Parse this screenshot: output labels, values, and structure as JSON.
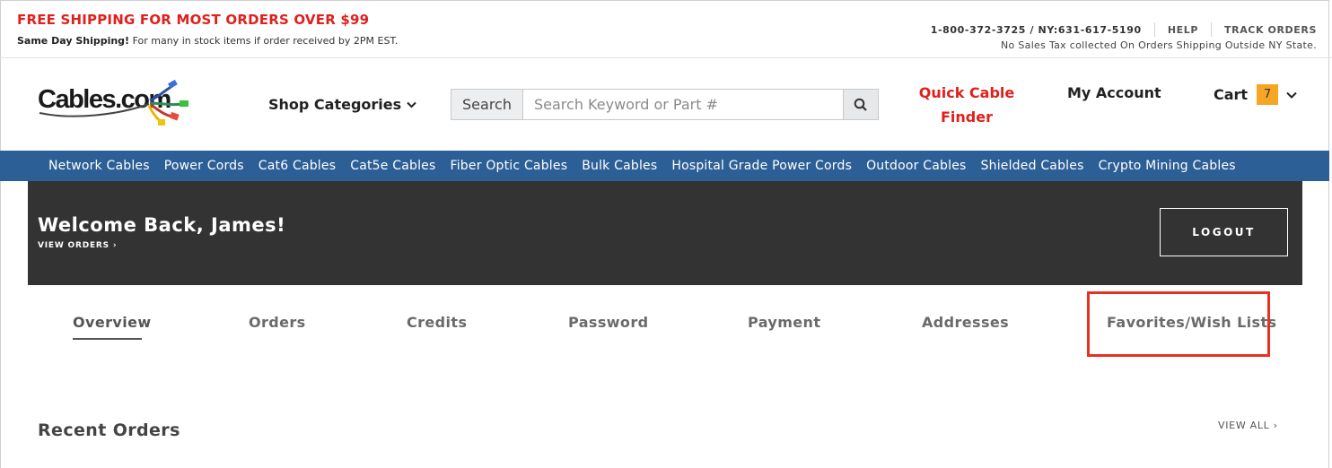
{
  "topbar": {
    "promo": "FREE SHIPPING FOR MOST ORDERS OVER $99",
    "same_day_bold": "Same Day Shipping!",
    "same_day_text": " For many in stock items if order received by 2PM EST.",
    "phone": "1-800-372-3725 / NY:631-617-5190",
    "help": "HELP",
    "track": "TRACK ORDERS",
    "no_sales_tax": "No Sales Tax collected On Orders Shipping Outside NY State."
  },
  "header": {
    "logo_text": "Cables.com",
    "shop_categories": "Shop Categories",
    "search_label": "Search",
    "search_placeholder": "Search Keyword or Part #",
    "search_value": "",
    "quick_finder_line1": "Quick Cable",
    "quick_finder_line2": "Finder",
    "my_account": "My Account",
    "cart_label": "Cart",
    "cart_count": "7"
  },
  "nav": {
    "items": [
      "Network Cables",
      "Power Cords",
      "Cat6 Cables",
      "Cat5e Cables",
      "Fiber Optic Cables",
      "Bulk Cables",
      "Hospital Grade Power Cords",
      "Outdoor Cables",
      "Shielded Cables",
      "Crypto Mining Cables"
    ]
  },
  "welcome": {
    "title": "Welcome Back, James!",
    "view_orders": "VIEW ORDERS ›",
    "logout": "LOGOUT"
  },
  "tabs": {
    "items": [
      "Overview",
      "Orders",
      "Credits",
      "Password",
      "Payment",
      "Addresses",
      "Favorites/Wish Lists"
    ],
    "active": "Overview"
  },
  "recent": {
    "title": "Recent Orders",
    "view_all": "VIEW ALL ›"
  },
  "colors": {
    "promo_red": "#e0201c",
    "nav_blue": "#2d5f97",
    "welcome_bg": "#333333",
    "cart_badge": "#f5a623",
    "highlight_red": "#e8301e"
  }
}
